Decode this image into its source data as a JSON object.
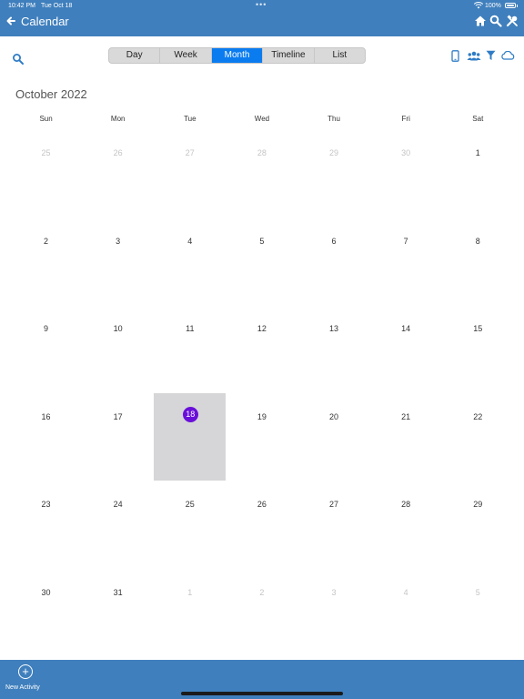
{
  "status_bar": {
    "time": "10:42 PM",
    "date": "Tue Oct 18",
    "battery": "100%"
  },
  "nav": {
    "title": "Calendar",
    "icons": [
      "back-arrow-icon",
      "home-icon",
      "search-icon",
      "tools-icon"
    ]
  },
  "view_switcher": {
    "options": [
      "Day",
      "Week",
      "Month",
      "Timeline",
      "List"
    ],
    "selected": "Month"
  },
  "toolbar_icons": [
    "search-icon",
    "device-icon",
    "people-icon",
    "filter-icon",
    "cloud-icon"
  ],
  "calendar": {
    "month_title": "October 2022",
    "weekdays": [
      "Sun",
      "Mon",
      "Tue",
      "Wed",
      "Thu",
      "Fri",
      "Sat"
    ],
    "weeks": [
      [
        {
          "d": "25",
          "out": true
        },
        {
          "d": "26",
          "out": true
        },
        {
          "d": "27",
          "out": true
        },
        {
          "d": "28",
          "out": true
        },
        {
          "d": "29",
          "out": true
        },
        {
          "d": "30",
          "out": true
        },
        {
          "d": "1"
        }
      ],
      [
        {
          "d": "2"
        },
        {
          "d": "3"
        },
        {
          "d": "4"
        },
        {
          "d": "5"
        },
        {
          "d": "6"
        },
        {
          "d": "7"
        },
        {
          "d": "8"
        }
      ],
      [
        {
          "d": "9"
        },
        {
          "d": "10"
        },
        {
          "d": "11"
        },
        {
          "d": "12"
        },
        {
          "d": "13"
        },
        {
          "d": "14"
        },
        {
          "d": "15"
        }
      ],
      [
        {
          "d": "16"
        },
        {
          "d": "17"
        },
        {
          "d": "18",
          "today": true
        },
        {
          "d": "19"
        },
        {
          "d": "20"
        },
        {
          "d": "21"
        },
        {
          "d": "22"
        }
      ],
      [
        {
          "d": "23"
        },
        {
          "d": "24"
        },
        {
          "d": "25"
        },
        {
          "d": "26"
        },
        {
          "d": "27"
        },
        {
          "d": "28"
        },
        {
          "d": "29"
        }
      ],
      [
        {
          "d": "30"
        },
        {
          "d": "31"
        },
        {
          "d": "1",
          "out": true
        },
        {
          "d": "2",
          "out": true
        },
        {
          "d": "3",
          "out": true
        },
        {
          "d": "4",
          "out": true
        },
        {
          "d": "5",
          "out": true
        }
      ]
    ]
  },
  "bottom_bar": {
    "new_activity_label": "New Activity"
  },
  "colors": {
    "bar": "#3f7fbd",
    "active_segment": "#0a7cf0",
    "today_dot": "#6a0fd9",
    "today_cell": "#d6d6d8",
    "icon_blue": "#2f7cc6"
  }
}
